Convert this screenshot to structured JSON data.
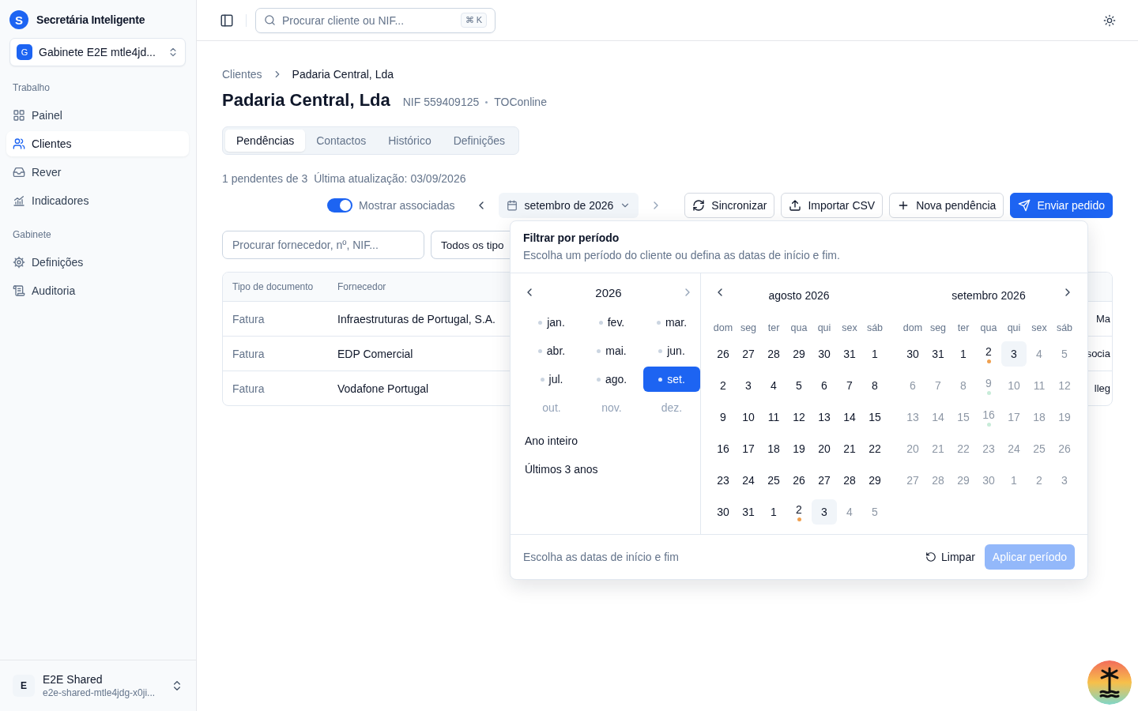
{
  "sidebar": {
    "logo": "S",
    "app_name": "Secretária Inteligente",
    "workspace": {
      "badge": "G",
      "name": "Gabinete E2E mtle4jd..."
    },
    "sections": [
      {
        "title": "Trabalho",
        "items": [
          {
            "label": "Painel",
            "selected": false
          },
          {
            "label": "Clientes",
            "selected": true
          },
          {
            "label": "Rever",
            "selected": false
          },
          {
            "label": "Indicadores",
            "selected": false
          }
        ]
      },
      {
        "title": "Gabinete",
        "items": [
          {
            "label": "Definições",
            "selected": false
          },
          {
            "label": "Auditoria",
            "selected": false
          }
        ]
      }
    ],
    "user": {
      "initial": "E",
      "name": "E2E Shared",
      "email": "e2e-shared-mtle4jdg-x0ji..."
    }
  },
  "topbar": {
    "search": {
      "placeholder": "Procurar cliente ou NIF...",
      "shortcut": "⌘ K"
    }
  },
  "breadcrumb": [
    "Clientes",
    "Padaria Central, Lda"
  ],
  "client": {
    "name": "Padaria Central, Lda",
    "nif": "NIF 559409125",
    "source": "TOConline"
  },
  "tabs": [
    {
      "label": "Pendências",
      "selected": true
    },
    {
      "label": "Contactos",
      "selected": false
    },
    {
      "label": "Histórico",
      "selected": false
    },
    {
      "label": "Definições",
      "selected": false
    }
  ],
  "summary": {
    "count": "1 pendentes de 3",
    "updated": "Última atualização: 03/09/2026"
  },
  "toolbar": {
    "toggle": {
      "label": "Mostrar associadas",
      "on": true
    },
    "period": "setembro de 2026",
    "buttons": [
      {
        "label": "Sincronizar",
        "kind": "outline"
      },
      {
        "label": "Importar CSV",
        "kind": "outline"
      },
      {
        "label": "Nova pendência",
        "kind": "outline"
      },
      {
        "label": "Enviar pedido",
        "kind": "primary"
      }
    ]
  },
  "filters": {
    "search": {
      "placeholder": "Procurar fornecedor, nº, NIF..."
    },
    "type_select": "Todos os tipo"
  },
  "table": {
    "columns": [
      "Tipo de documento",
      "Fornecedor"
    ],
    "rows": [
      {
        "cells": [
          "Fatura",
          "Infraestruturas de Portugal, S.A.",
          "Ma"
        ]
      },
      {
        "cells": [
          "Fatura",
          "EDP Comercial",
          "socia"
        ]
      },
      {
        "cells": [
          "Fatura",
          "Vodafone Portugal",
          "lleg"
        ]
      }
    ]
  },
  "period_popover": {
    "title": "Filtrar por período",
    "subtitle": "Escolha um período do cliente ou defina as datas de início e fim.",
    "year": "2026",
    "months": [
      {
        "label": "jan.",
        "selected": false,
        "disabled": false,
        "dot": true
      },
      {
        "label": "fev.",
        "selected": false,
        "disabled": false,
        "dot": true
      },
      {
        "label": "mar.",
        "selected": false,
        "disabled": false,
        "dot": true
      },
      {
        "label": "abr.",
        "selected": false,
        "disabled": false,
        "dot": true
      },
      {
        "label": "mai.",
        "selected": false,
        "disabled": false,
        "dot": true
      },
      {
        "label": "jun.",
        "selected": false,
        "disabled": false,
        "dot": true
      },
      {
        "label": "jul.",
        "selected": false,
        "disabled": false,
        "dot": true
      },
      {
        "label": "ago.",
        "selected": false,
        "disabled": false,
        "dot": true
      },
      {
        "label": "set.",
        "selected": true,
        "disabled": false,
        "dot": true
      },
      {
        "label": "out.",
        "selected": false,
        "disabled": true,
        "dot": false
      },
      {
        "label": "nov.",
        "selected": false,
        "disabled": true,
        "dot": false
      },
      {
        "label": "dez.",
        "selected": false,
        "disabled": true,
        "dot": false
      }
    ],
    "presets": [
      "Ano inteiro",
      "Últimos 3 anos"
    ],
    "calendars": [
      {
        "title": "agosto 2026",
        "weekdays": [
          "dom",
          "seg",
          "ter",
          "qua",
          "qui",
          "sex",
          "sáb"
        ],
        "weeks": [
          [
            {
              "label": "26",
              "disabled": false,
              "today": false
            },
            {
              "label": "27",
              "disabled": false,
              "today": false
            },
            {
              "label": "28",
              "disabled": false,
              "today": false
            },
            {
              "label": "29",
              "disabled": false,
              "today": false
            },
            {
              "label": "30",
              "disabled": false,
              "today": false
            },
            {
              "label": "31",
              "disabled": false,
              "today": false
            },
            {
              "label": "1",
              "disabled": false,
              "today": false
            }
          ],
          [
            {
              "label": "2",
              "disabled": false,
              "today": false
            },
            {
              "label": "3",
              "disabled": false,
              "today": false
            },
            {
              "label": "4",
              "disabled": false,
              "today": false
            },
            {
              "label": "5",
              "disabled": false,
              "today": false
            },
            {
              "label": "6",
              "disabled": false,
              "today": false
            },
            {
              "label": "7",
              "disabled": false,
              "today": false
            },
            {
              "label": "8",
              "disabled": false,
              "today": false
            }
          ],
          [
            {
              "label": "9",
              "disabled": false,
              "today": false
            },
            {
              "label": "10",
              "disabled": false,
              "today": false
            },
            {
              "label": "11",
              "disabled": false,
              "today": false
            },
            {
              "label": "12",
              "disabled": false,
              "today": false
            },
            {
              "label": "13",
              "disabled": false,
              "today": false
            },
            {
              "label": "14",
              "disabled": false,
              "today": false
            },
            {
              "label": "15",
              "disabled": false,
              "today": false
            }
          ],
          [
            {
              "label": "16",
              "disabled": false,
              "today": false
            },
            {
              "label": "17",
              "disabled": false,
              "today": false
            },
            {
              "label": "18",
              "disabled": false,
              "today": false
            },
            {
              "label": "19",
              "disabled": false,
              "today": false
            },
            {
              "label": "20",
              "disabled": false,
              "today": false
            },
            {
              "label": "21",
              "disabled": false,
              "today": false
            },
            {
              "label": "22",
              "disabled": false,
              "today": false
            }
          ],
          [
            {
              "label": "23",
              "disabled": false,
              "today": false
            },
            {
              "label": "24",
              "disabled": false,
              "today": false
            },
            {
              "label": "25",
              "disabled": false,
              "today": false
            },
            {
              "label": "26",
              "disabled": false,
              "today": false
            },
            {
              "label": "27",
              "disabled": false,
              "today": false
            },
            {
              "label": "28",
              "disabled": false,
              "today": false
            },
            {
              "label": "29",
              "disabled": false,
              "today": false
            }
          ],
          [
            {
              "label": "30",
              "disabled": false,
              "today": false
            },
            {
              "label": "31",
              "disabled": false,
              "today": false
            },
            {
              "label": "1",
              "disabled": false,
              "today": false
            },
            {
              "label": "2",
              "disabled": false,
              "today": false,
              "color": "#f0a050"
            },
            {
              "label": "3",
              "disabled": false,
              "today": true
            },
            {
              "label": "4",
              "disabled": true,
              "today": false
            },
            {
              "label": "5",
              "disabled": true,
              "today": false
            }
          ]
        ]
      },
      {
        "title": "setembro 2026",
        "weekdays": [
          "dom",
          "seg",
          "ter",
          "qua",
          "qui",
          "sex",
          "sáb"
        ],
        "weeks": [
          [
            {
              "label": "30",
              "disabled": false,
              "today": false
            },
            {
              "label": "31",
              "disabled": false,
              "today": false
            },
            {
              "label": "1",
              "disabled": false,
              "today": false
            },
            {
              "label": "2",
              "disabled": false,
              "today": false,
              "color": "#f0a050"
            },
            {
              "label": "3",
              "disabled": false,
              "today": true
            },
            {
              "label": "4",
              "disabled": true,
              "today": false
            },
            {
              "label": "5",
              "disabled": true,
              "today": false
            }
          ],
          [
            {
              "label": "6",
              "disabled": true,
              "today": false
            },
            {
              "label": "7",
              "disabled": true,
              "today": false
            },
            {
              "label": "8",
              "disabled": true,
              "today": false
            },
            {
              "label": "9",
              "disabled": true,
              "today": false,
              "color": "#c8ecd9"
            },
            {
              "label": "10",
              "disabled": true,
              "today": false
            },
            {
              "label": "11",
              "disabled": true,
              "today": false
            },
            {
              "label": "12",
              "disabled": true,
              "today": false
            }
          ],
          [
            {
              "label": "13",
              "disabled": true,
              "today": false
            },
            {
              "label": "14",
              "disabled": true,
              "today": false
            },
            {
              "label": "15",
              "disabled": true,
              "today": false
            },
            {
              "label": "16",
              "disabled": true,
              "today": false,
              "color": "#c8ecd9"
            },
            {
              "label": "17",
              "disabled": true,
              "today": false
            },
            {
              "label": "18",
              "disabled": true,
              "today": false
            },
            {
              "label": "19",
              "disabled": true,
              "today": false
            }
          ],
          [
            {
              "label": "20",
              "disabled": true,
              "today": false
            },
            {
              "label": "21",
              "disabled": true,
              "today": false
            },
            {
              "label": "22",
              "disabled": true,
              "today": false
            },
            {
              "label": "23",
              "disabled": true,
              "today": false
            },
            {
              "label": "24",
              "disabled": true,
              "today": false
            },
            {
              "label": "25",
              "disabled": true,
              "today": false
            },
            {
              "label": "26",
              "disabled": true,
              "today": false
            }
          ],
          [
            {
              "label": "27",
              "disabled": true,
              "today": false
            },
            {
              "label": "28",
              "disabled": true,
              "today": false
            },
            {
              "label": "29",
              "disabled": true,
              "today": false
            },
            {
              "label": "30",
              "disabled": true,
              "today": false
            },
            {
              "label": "1",
              "disabled": true,
              "today": false
            },
            {
              "label": "2",
              "disabled": true,
              "today": false
            },
            {
              "label": "3",
              "disabled": true,
              "today": false
            }
          ]
        ]
      }
    ],
    "footer_hint": "Escolha as datas de início e fim",
    "clear": "Limpar",
    "apply": {
      "label": "Aplicar período",
      "disabled": true
    }
  }
}
